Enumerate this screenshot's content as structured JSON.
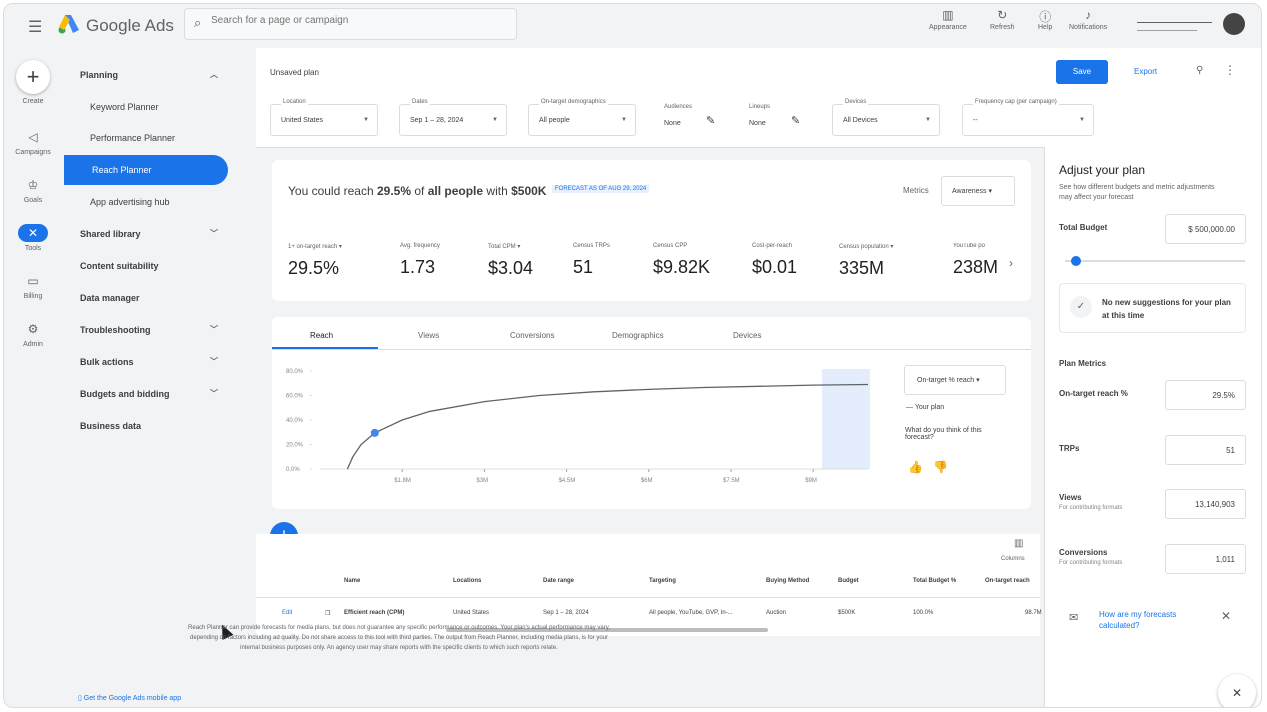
{
  "app": {
    "name": "Google Ads",
    "search_placeholder": "Search for a page or campaign"
  },
  "top_actions": [
    {
      "label": "Appearance",
      "icon": "appearance-icon"
    },
    {
      "label": "Refresh",
      "icon": "refresh-icon"
    },
    {
      "label": "Help",
      "icon": "help-icon"
    },
    {
      "label": "Notifications",
      "icon": "bell-icon"
    }
  ],
  "rail": [
    {
      "label": "Create",
      "icon": "plus-icon"
    },
    {
      "label": "Campaigns",
      "icon": "megaphone-icon"
    },
    {
      "label": "Goals",
      "icon": "trophy-icon"
    },
    {
      "label": "Tools",
      "icon": "tools-icon"
    },
    {
      "label": "Billing",
      "icon": "billing-icon"
    },
    {
      "label": "Admin",
      "icon": "gear-icon"
    }
  ],
  "nav": {
    "planning": "Planning",
    "keyword_planner": "Keyword Planner",
    "performance_planner": "Performance Planner",
    "reach_planner": "Reach Planner",
    "app_advertising_hub": "App advertising hub",
    "shared_library": "Shared library",
    "content_suitability": "Content suitability",
    "data_manager": "Data manager",
    "troubleshooting": "Troubleshooting",
    "bulk_actions": "Bulk actions",
    "budgets_bidding": "Budgets and bidding",
    "business_data": "Business data",
    "mobile_app": "Get the Google Ads mobile app"
  },
  "header": {
    "plan_name": "Unsaved plan",
    "save": "Save",
    "export": "Export"
  },
  "filters": {
    "location": {
      "label": "Location",
      "value": "United States"
    },
    "dates": {
      "label": "Dates",
      "value": "Sep 1 – 28, 2024"
    },
    "demographics": {
      "label": "On-target demographics",
      "value": "All people"
    },
    "audiences": {
      "label": "Audiences",
      "value": "None"
    },
    "lineups": {
      "label": "Lineups",
      "value": "None"
    },
    "devices": {
      "label": "Devices",
      "value": "All Devices"
    },
    "frequency": {
      "label": "Frequency cap (per campaign)",
      "value": "--"
    }
  },
  "summary": {
    "prefix": "You could reach",
    "percent": "29.5%",
    "mid": "of",
    "audience": "all people",
    "with": "with",
    "budget": "$500K",
    "forecast": "FORECAST AS OF AUG 29, 2024",
    "metrics_label": "Metrics",
    "metrics_value": "Awareness"
  },
  "metrics": [
    {
      "label": "1+ on-target reach ▾",
      "value": "29.5%"
    },
    {
      "label": "Avg. frequency",
      "value": "1.73"
    },
    {
      "label": "Total CPM ▾",
      "value": "$3.04"
    },
    {
      "label": "Census TRPs",
      "value": "51"
    },
    {
      "label": "Census CPP",
      "value": "$9.82K"
    },
    {
      "label": "Cost-per-reach",
      "value": "$0.01"
    },
    {
      "label": "Census population ▾",
      "value": "335M"
    },
    {
      "label": "YouTube po",
      "value": "238M"
    }
  ],
  "tabs": [
    "Reach",
    "Views",
    "Conversions",
    "Demographics",
    "Devices"
  ],
  "chart_data": {
    "type": "line",
    "title": "",
    "xlabel": "",
    "ylabel": "",
    "x_tick_labels": [
      "$1.8M",
      "$3M",
      "$4.5M",
      "$6M",
      "$7.5M",
      "$9M"
    ],
    "y_tick_labels": [
      "0.0%",
      "20.0%",
      "40.0%",
      "60.0%",
      "80.0%"
    ],
    "ylim": [
      0,
      80
    ],
    "series": [
      {
        "name": "Your plan",
        "x": [
          0.5,
          0.6,
          0.75,
          1,
          1.5,
          2,
          3,
          4,
          5,
          6,
          7,
          8,
          9,
          10
        ],
        "y": [
          0,
          10,
          20,
          29.5,
          40,
          47,
          55,
          60,
          63,
          65,
          66.5,
          67.5,
          68.5,
          69
        ]
      }
    ],
    "marker": {
      "x": 1,
      "y": 29.5
    },
    "selected_metric": "On-target % reach",
    "feedback_question": "What do you think of this forecast?"
  },
  "table": {
    "columns_label": "Columns",
    "headers": [
      "Name",
      "Locations",
      "Date range",
      "Targeting",
      "Buying Method",
      "Budget",
      "Total Budget %",
      "On-target reach"
    ],
    "row": {
      "edit": "Edit",
      "name": "Efficient reach (CPM)",
      "location": "United States",
      "date_range": "Sep 1 – 28, 2024",
      "targeting": "All people, YouTube, GVP, In-...",
      "buying_method": "Auction",
      "budget": "$500K",
      "total_budget_pct": "100.0%",
      "reach": "98.7M"
    }
  },
  "disclaimer": "Reach Planner can provide forecasts for media plans, but does not guarantee any specific performance or outcomes. Your plan's actual performance may vary, depending on factors including ad quality. Do not share access to this tool with third parties. The output from Reach Planner, including media plans, is for your internal business purposes only. An agency user may share reports with the specific clients to which such reports relate.",
  "adjust": {
    "title": "Adjust your plan",
    "subtitle": "See how different budgets and metric adjustments may affect your forecast",
    "total_budget_label": "Total Budget",
    "total_budget_value": "$ 500,000.00",
    "budget_slider_level": 0.04,
    "suggestion": "No new suggestions for your plan at this time",
    "plan_metrics": "Plan Metrics",
    "on_target_label": "On-target reach %",
    "on_target_value": "29.5%",
    "trps_label": "TRPs",
    "trps_value": "51",
    "views_label": "Views",
    "views_sub": "For contributing formats",
    "views_value": "13,140,903",
    "conversions_label": "Conversions",
    "conversions_sub": "For contributing formats",
    "conversions_value": "1,011",
    "how_link": "How are my forecasts calculated?"
  }
}
